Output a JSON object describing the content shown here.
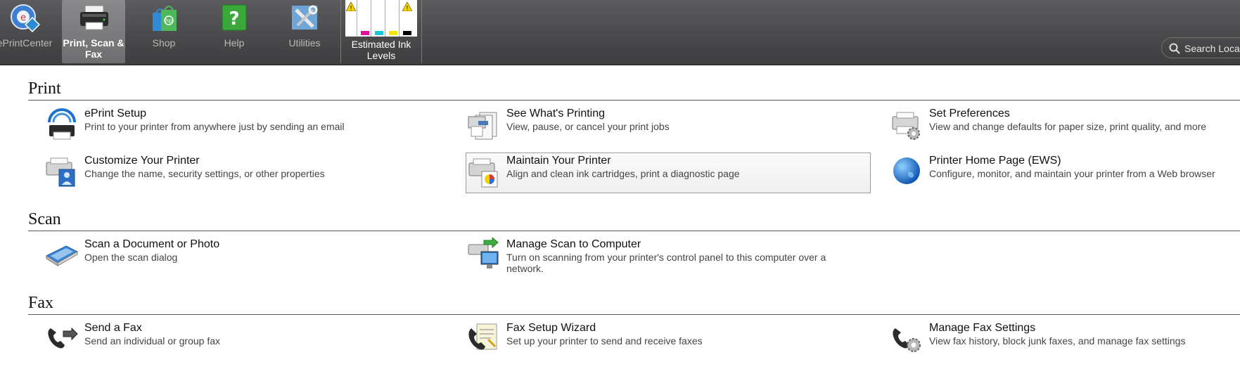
{
  "toolbar": {
    "items": [
      {
        "label": "ePrintCenter",
        "icon": "eprint-center-icon"
      },
      {
        "label": "Print, Scan & Fax",
        "icon": "printer-icon",
        "active": true
      },
      {
        "label": "Shop",
        "icon": "shopping-bag-icon"
      },
      {
        "label": "Help",
        "icon": "help-icon"
      },
      {
        "label": "Utilities",
        "icon": "tools-icon"
      }
    ],
    "ink": {
      "label": "Estimated Ink Levels",
      "cartridges": [
        {
          "color": "#000000",
          "warning": true
        },
        {
          "color": "#e0129a",
          "warning": false
        },
        {
          "color": "#18c6da",
          "warning": false
        },
        {
          "color": "#f2e600",
          "warning": false
        },
        {
          "color": "#000000",
          "warning": true
        }
      ]
    },
    "search": {
      "placeholder": "Search Loca"
    }
  },
  "sections": {
    "print": {
      "title": "Print",
      "tasks": [
        {
          "title": "ePrint Setup",
          "desc": "Print to your printer from anywhere just by sending an email",
          "icon": "eprint-icon"
        },
        {
          "title": "See What's Printing",
          "desc": "View, pause, or cancel your print jobs",
          "icon": "print-queue-icon"
        },
        {
          "title": "Set Preferences",
          "desc": "View and change defaults for paper size, print quality, and more",
          "icon": "printer-settings-icon"
        },
        {
          "title": "Customize Your Printer",
          "desc": "Change the name, security settings, or other properties",
          "icon": "printer-customize-icon"
        },
        {
          "title": "Maintain Your Printer",
          "desc": "Align and clean ink cartridges, print a diagnostic page",
          "icon": "printer-maintain-icon"
        },
        {
          "title": "Printer Home Page (EWS)",
          "desc": "Configure, monitor, and maintain your printer from a Web browser",
          "icon": "globe-icon"
        }
      ]
    },
    "scan": {
      "title": "Scan",
      "tasks": [
        {
          "title": "Scan a Document or Photo",
          "desc": "Open the scan dialog",
          "icon": "scanner-icon"
        },
        {
          "title": "Manage Scan to Computer",
          "desc": "Turn on scanning from your printer's control panel to this computer over a network.",
          "icon": "scan-to-computer-icon"
        }
      ]
    },
    "fax": {
      "title": "Fax",
      "tasks": [
        {
          "title": "Send a Fax",
          "desc": "Send an individual or group fax",
          "icon": "send-fax-icon"
        },
        {
          "title": "Fax Setup Wizard",
          "desc": "Set up your printer to send and receive faxes",
          "icon": "fax-wizard-icon"
        },
        {
          "title": "Manage Fax Settings",
          "desc": "View fax history, block junk faxes, and manage fax settings",
          "icon": "fax-settings-icon"
        }
      ]
    }
  }
}
